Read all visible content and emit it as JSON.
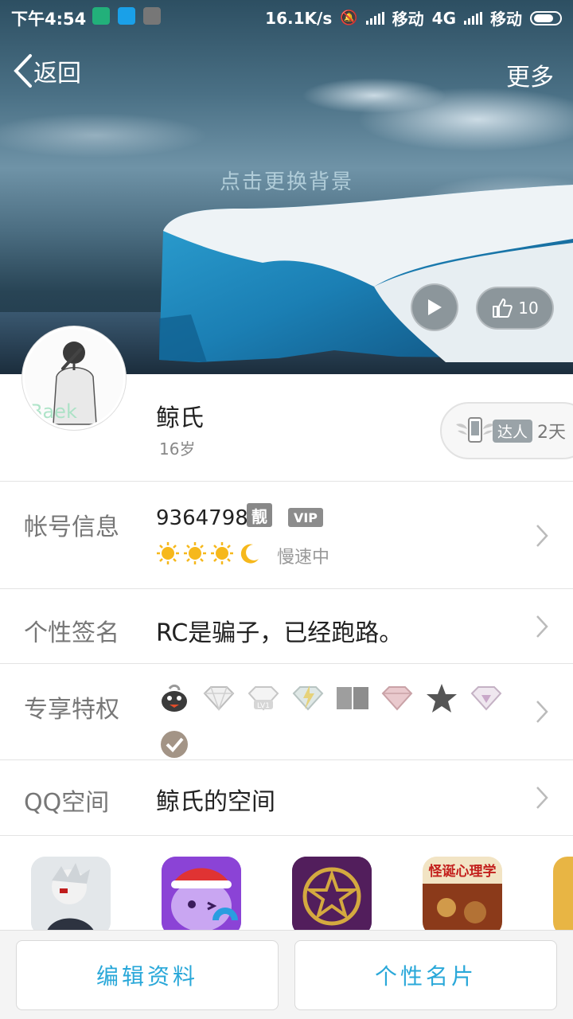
{
  "status_bar": {
    "time": "下午4:54",
    "speed": "16.1K/s",
    "carrier1": "移动",
    "network": "4G",
    "carrier2": "移动"
  },
  "nav": {
    "back_label": "返回",
    "more_label": "更多"
  },
  "header": {
    "change_background": "点击更换背景",
    "like_count": "10"
  },
  "profile": {
    "name": "鲸氏",
    "age": "16岁",
    "badge_tag": "达人",
    "badge_days": "2天"
  },
  "account": {
    "label": "帐号信息",
    "number": "93647987",
    "tag_liang": "靓",
    "tag_vip": "VIP",
    "speed_status": "慢速中"
  },
  "signature": {
    "label": "个性签名",
    "text": "RC是骗子，已经跑路。"
  },
  "privileges": {
    "label": "专享特权",
    "icons": [
      "qq-penguin-icon",
      "white-diamond-icon",
      "lv1-diamond-icon",
      "lightning-diamond-icon",
      "book-icon",
      "pink-diamond-icon",
      "star-icon",
      "purple-diamond-icon",
      "check-badge-icon"
    ]
  },
  "qzone": {
    "label": "QQ空间",
    "text": "鲸氏的空间"
  },
  "apps": {
    "app3_text": "怪诞心理学"
  },
  "buttons": {
    "edit_profile": "编辑资料",
    "business_card": "个性名片"
  },
  "colors": {
    "accent": "#2aa8d9",
    "label_gray": "#777777",
    "divider": "#e3e3e3"
  }
}
